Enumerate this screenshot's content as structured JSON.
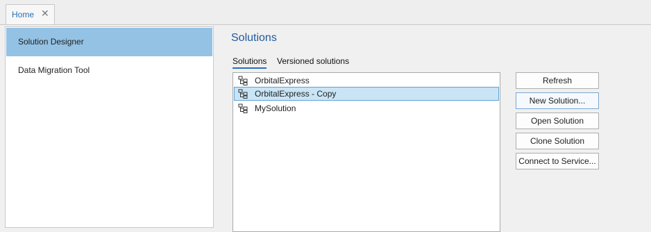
{
  "tabs": [
    {
      "label": "Home",
      "close_icon": "close-icon"
    }
  ],
  "nav": {
    "items": [
      {
        "label": "Solution Designer",
        "selected": true
      },
      {
        "label": "Data Migration Tool",
        "selected": false
      }
    ]
  },
  "main": {
    "title": "Solutions",
    "subtabs": [
      {
        "label": "Solutions",
        "active": true
      },
      {
        "label": "Versioned solutions",
        "active": false
      }
    ],
    "solutions": [
      {
        "name": "OrbitalExpress",
        "icon": "solution-tree-icon",
        "selected": false
      },
      {
        "name": "OrbitalExpress - Copy",
        "icon": "solution-tree-icon",
        "selected": true
      },
      {
        "name": "MySolution",
        "icon": "solution-tree-icon",
        "selected": false
      }
    ],
    "buttons": {
      "refresh": "Refresh",
      "new_solution": "New Solution...",
      "open_solution": "Open Solution",
      "clone_solution": "Clone Solution",
      "connect_to_service": "Connect to Service..."
    }
  },
  "colors": {
    "accent": "#2a6fb5",
    "nav_selected": "#94c2e4",
    "row_selected": "#c9e5f5",
    "title": "#1f5a9c"
  }
}
